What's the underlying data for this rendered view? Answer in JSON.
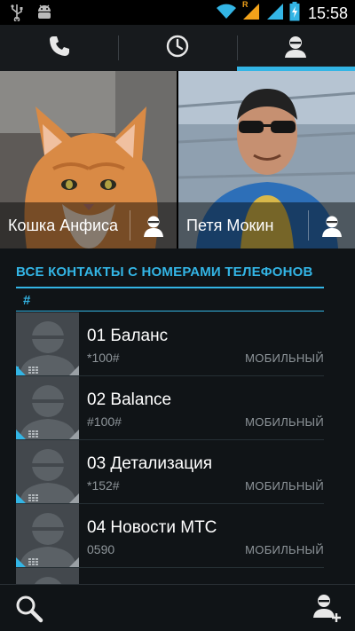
{
  "status_bar": {
    "time": "15:58",
    "icons": [
      "usb-icon",
      "android-icon",
      "wifi-icon",
      "signal-icon",
      "signal-icon",
      "battery-charging-icon"
    ],
    "roaming_mark": "R"
  },
  "tabs": [
    {
      "icon": "phone-icon",
      "active": false
    },
    {
      "icon": "clock-icon",
      "active": false
    },
    {
      "icon": "person-icon",
      "active": true
    }
  ],
  "favorites": [
    {
      "name": "Кошка Анфиса",
      "icon": "person-icon"
    },
    {
      "name": "Петя Мокин",
      "icon": "person-icon"
    }
  ],
  "list": {
    "section_title": "ВСЕ КОНТАКТЫ С НОМЕРАМИ ТЕЛЕФОНОВ",
    "index_letter": "#",
    "contacts": [
      {
        "name": "01 Баланс",
        "number": "*100#",
        "type": "МОБИЛЬНЫЙ"
      },
      {
        "name": "02 Balance",
        "number": "#100#",
        "type": "МОБИЛЬНЫЙ"
      },
      {
        "name": "03 Детализация",
        "number": "*152#",
        "type": "МОБИЛЬНЫЙ"
      },
      {
        "name": "04 Новости МТС",
        "number": "0590",
        "type": "МОБИЛЬНЫЙ"
      }
    ]
  },
  "bottom_bar": {
    "left_icon": "search-icon",
    "right_icon": "add-contact-icon"
  },
  "colors": {
    "accent": "#33b5e5",
    "background": "#101417",
    "secondary_text": "#8e959a"
  }
}
